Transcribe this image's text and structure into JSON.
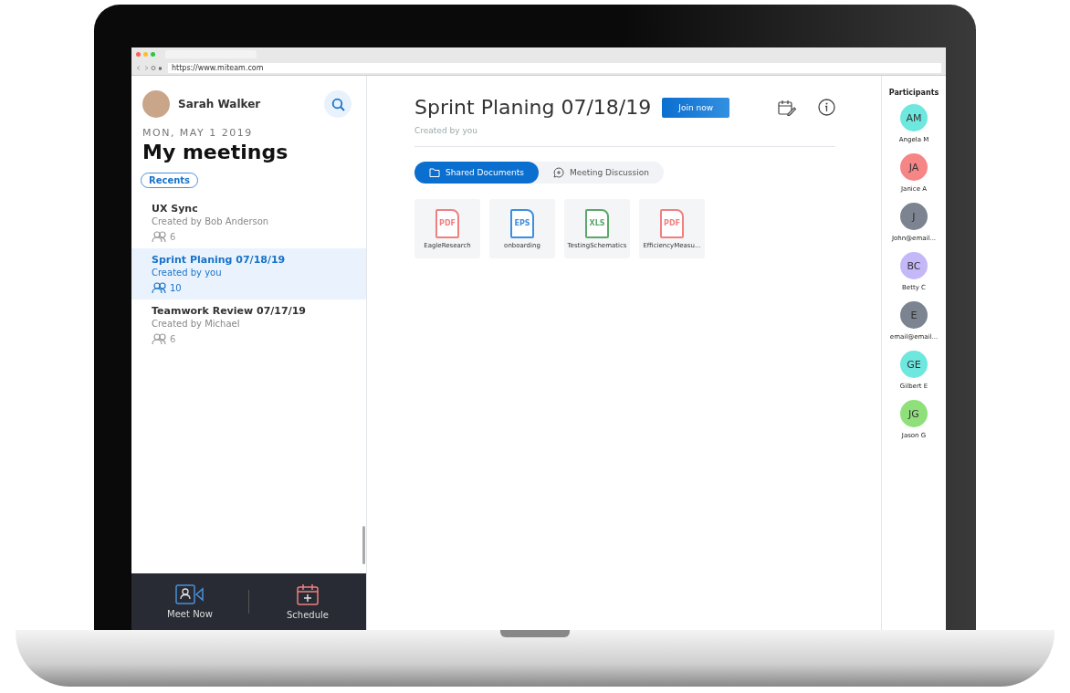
{
  "browser": {
    "url": "https://www.miteam.com"
  },
  "user": {
    "name": "Sarah Walker"
  },
  "date": "MON, MAY 1 2019",
  "heading": "My meetings",
  "filter": "Recents",
  "meetings": [
    {
      "title": "UX Sync",
      "creator": "Created by Bob Anderson",
      "count": "6",
      "selected": false
    },
    {
      "title": "Sprint Planing 07/18/19",
      "creator": "Created by you",
      "count": "10",
      "selected": true
    },
    {
      "title": "Teamwork Review 07/17/19",
      "creator": "Created by Michael",
      "count": "6",
      "selected": false
    }
  ],
  "bottom_bar": [
    {
      "kind": "video",
      "label": "Meet Now"
    },
    {
      "kind": "calendar",
      "label": "Schedule"
    }
  ],
  "meeting": {
    "title": "Sprint Planing 07/18/19",
    "join": "Join now",
    "subtitle": "Created by you"
  },
  "tabs": [
    {
      "kind": "folder",
      "label": "Shared Documents",
      "selected": true
    },
    {
      "kind": "chat",
      "label": "Meeting Discussion",
      "selected": false
    }
  ],
  "documents": [
    {
      "type": "PDF",
      "color": "#f08080",
      "name": "EagleResearch"
    },
    {
      "type": "EPS",
      "color": "#3d8ee0",
      "name": "onboarding"
    },
    {
      "type": "XLS",
      "color": "#5aa86a",
      "name": "TestingSchematics"
    },
    {
      "type": "PDF",
      "color": "#f08080",
      "name": "EfficiencyMeasu..."
    }
  ],
  "participants_title": "Participants",
  "participants": [
    {
      "initials": "AM",
      "name": "Angela M",
      "color": "#6ee7df"
    },
    {
      "initials": "JA",
      "name": "Janice A",
      "color": "#f68585"
    },
    {
      "initials": "J",
      "name": "John@email...",
      "color": "#7b8490"
    },
    {
      "initials": "BC",
      "name": "Betty C",
      "color": "#c5b8f8"
    },
    {
      "initials": "E",
      "name": "email@email...",
      "color": "#7b8490"
    },
    {
      "initials": "GE",
      "name": "Gilbert E",
      "color": "#6ee7df"
    },
    {
      "initials": "JG",
      "name": "Jason G",
      "color": "#8fe07a"
    }
  ]
}
